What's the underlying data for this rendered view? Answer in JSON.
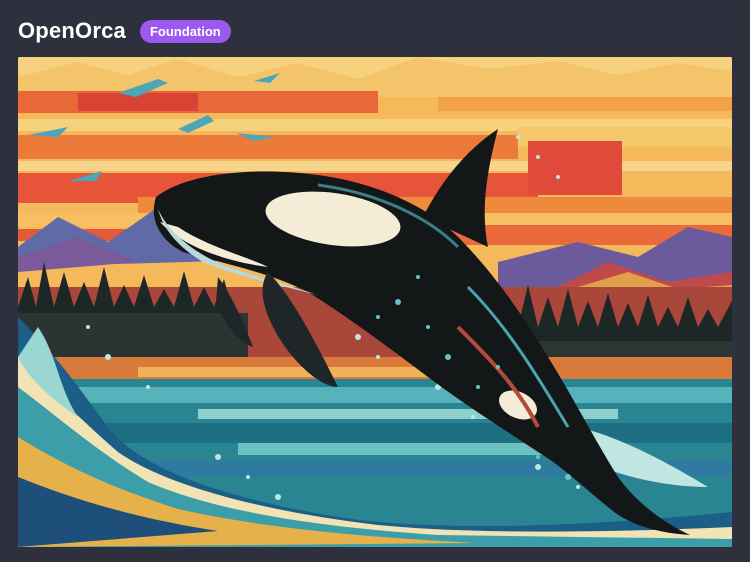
{
  "header": {
    "title": "OpenOrca",
    "badge": "Foundation"
  },
  "image": {
    "subject": "orca-leaping-illustration",
    "colors": {
      "sky_top": "#f6c96a",
      "sky_orange": "#f08a3a",
      "sky_red": "#e2553a",
      "mountain_blue": "#6d6fa8",
      "mountain_purple": "#8a5a9a",
      "forest": "#1f2a2a",
      "water_teal": "#2e8e98",
      "water_light": "#9ad6d2",
      "wave_cream": "#f3e4b6",
      "orca_black": "#141718",
      "orca_white": "#f4ecd6"
    }
  }
}
